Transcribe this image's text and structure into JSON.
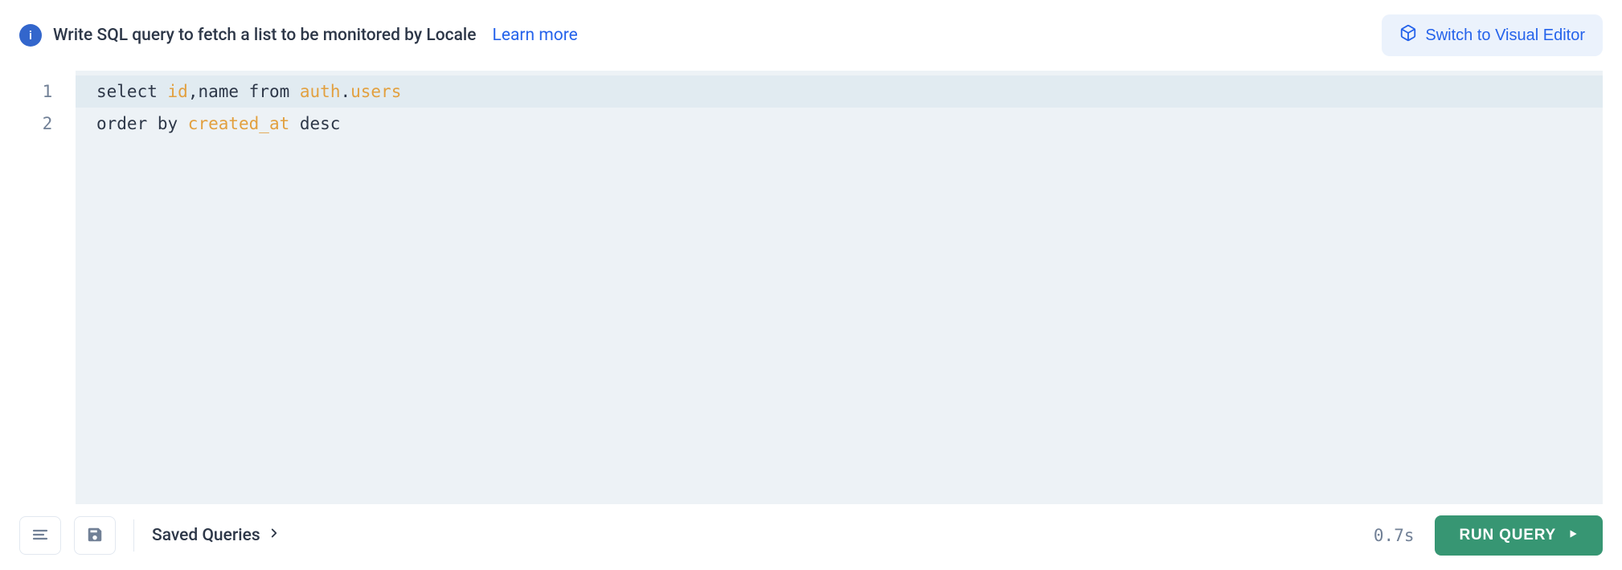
{
  "header": {
    "info_text": "Write SQL query to fetch a list to be monitored by Locale",
    "learn_more": "Learn more",
    "switch_label": "Switch to Visual Editor"
  },
  "editor": {
    "line_numbers": [
      "1",
      "2"
    ],
    "lines": [
      {
        "tokens": [
          {
            "t": "select ",
            "c": "plain"
          },
          {
            "t": "id",
            "c": "kw"
          },
          {
            "t": ",name from ",
            "c": "plain"
          },
          {
            "t": "auth",
            "c": "kw"
          },
          {
            "t": ".",
            "c": "plain"
          },
          {
            "t": "users",
            "c": "kw"
          }
        ],
        "current": true
      },
      {
        "tokens": [
          {
            "t": "order by ",
            "c": "plain"
          },
          {
            "t": "created_at",
            "c": "kw"
          },
          {
            "t": " desc",
            "c": "plain"
          }
        ],
        "current": false
      }
    ]
  },
  "footer": {
    "saved_queries": "Saved Queries",
    "timing": "0.7s",
    "run_label": "RUN QUERY"
  }
}
